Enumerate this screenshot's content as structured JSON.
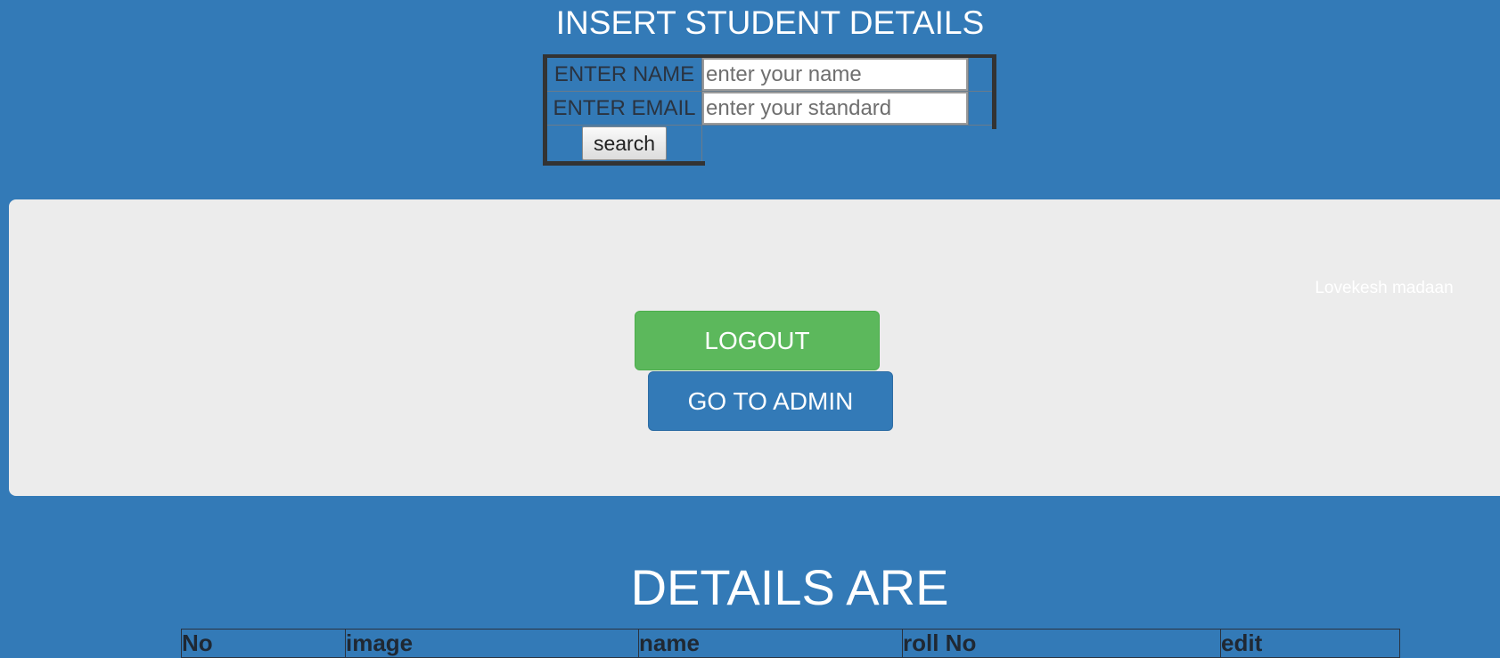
{
  "insert_form": {
    "title": "INSERT STUDENT DETAILS",
    "name_label": "ENTER NAME",
    "name_placeholder": "enter your name",
    "email_label": "ENTER EMAIL",
    "email_placeholder": "enter your standard",
    "search_label": "search"
  },
  "panel": {
    "user_name": "Lovekesh madaan",
    "logout_label": "LOGOUT",
    "admin_label": "GO TO ADMIN"
  },
  "details": {
    "heading": "DETAILS ARE",
    "columns": [
      "No",
      "image",
      "name",
      "roll No",
      "edit"
    ]
  },
  "colors": {
    "background": "#337ab7",
    "panel": "#ececec",
    "logout": "#5cb85c",
    "admin": "#337ab7"
  }
}
